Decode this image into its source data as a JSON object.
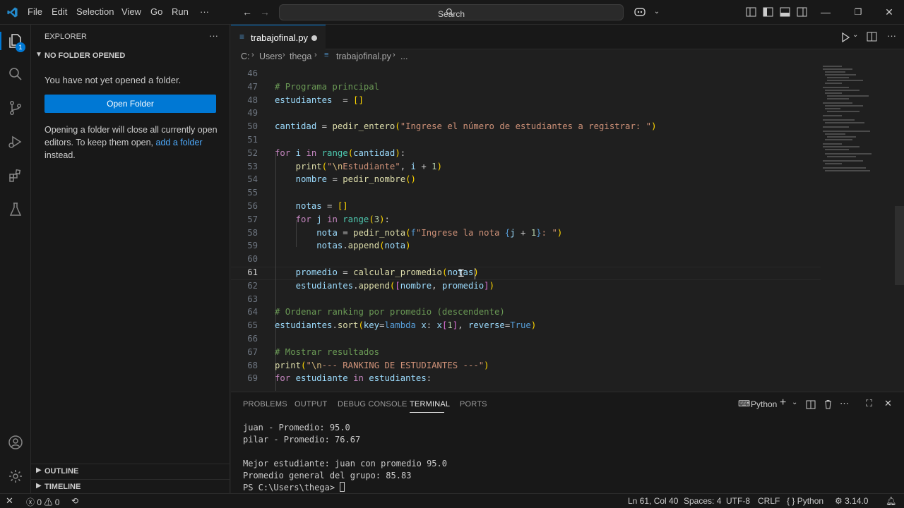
{
  "menu": {
    "file": "File",
    "edit": "Edit",
    "selection": "Selection",
    "view": "View",
    "go": "Go",
    "run": "Run",
    "more": "···"
  },
  "search": {
    "label": "Search"
  },
  "sidebar": {
    "title": "EXPLORER",
    "more": "···",
    "section": "NO FOLDER OPENED",
    "message": "You have not yet opened a folder.",
    "open_folder": "Open Folder",
    "info_1": "Opening a folder will close all currently open",
    "info_2": "editors. To keep them open,",
    "info_link": "add a folder",
    "info_3": "instead.",
    "outline": "OUTLINE",
    "timeline": "TIMELINE"
  },
  "badge": "1",
  "tab": {
    "name": "trabajofinal.py"
  },
  "breadcrumb": {
    "drive": "C:",
    "users": "Users",
    "user": "thega",
    "file": "trabajofinal.py",
    "more": "..."
  },
  "editor": {
    "lines": [
      {
        "n": "46"
      },
      {
        "n": "47",
        "t": [
          [
            "cmt",
            "# Programa principal"
          ]
        ]
      },
      {
        "n": "48",
        "t": [
          [
            "var",
            "estudiantes"
          ],
          [
            "",
            "  = "
          ],
          [
            "br1",
            "[]"
          ]
        ]
      },
      {
        "n": "49"
      },
      {
        "n": "50",
        "t": [
          [
            "var",
            "cantidad"
          ],
          [
            "",
            " = "
          ],
          [
            "fn",
            "pedir_entero"
          ],
          [
            "br1",
            "("
          ],
          [
            "str",
            "\"Ingrese el número de estudiantes a registrar: \""
          ],
          [
            "br1",
            ")"
          ]
        ]
      },
      {
        "n": "51"
      },
      {
        "n": "52",
        "t": [
          [
            "kw",
            "for"
          ],
          [
            "",
            " "
          ],
          [
            "var",
            "i"
          ],
          [
            "",
            " "
          ],
          [
            "kw",
            "in"
          ],
          [
            "",
            " "
          ],
          [
            "cls",
            "range"
          ],
          [
            "br1",
            "("
          ],
          [
            "var",
            "cantidad"
          ],
          [
            "br1",
            ")"
          ],
          [
            "",
            ":"
          ]
        ]
      },
      {
        "n": "53",
        "t": [
          [
            "",
            "    "
          ],
          [
            "fn",
            "print"
          ],
          [
            "br1",
            "("
          ],
          [
            "str",
            "\""
          ],
          [
            "esc",
            "\\n"
          ],
          [
            "str",
            "Estudiante\""
          ],
          [
            "",
            ", "
          ],
          [
            "var",
            "i"
          ],
          [
            "",
            " + "
          ],
          [
            "num",
            "1"
          ],
          [
            "br1",
            ")"
          ]
        ]
      },
      {
        "n": "54",
        "t": [
          [
            "",
            "    "
          ],
          [
            "var",
            "nombre"
          ],
          [
            "",
            " = "
          ],
          [
            "fn",
            "pedir_nombre"
          ],
          [
            "br1",
            "()"
          ]
        ]
      },
      {
        "n": "55"
      },
      {
        "n": "56",
        "t": [
          [
            "",
            "    "
          ],
          [
            "var",
            "notas"
          ],
          [
            "",
            " = "
          ],
          [
            "br1",
            "[]"
          ]
        ]
      },
      {
        "n": "57",
        "t": [
          [
            "",
            "    "
          ],
          [
            "kw",
            "for"
          ],
          [
            "",
            " "
          ],
          [
            "var",
            "j"
          ],
          [
            "",
            " "
          ],
          [
            "kw",
            "in"
          ],
          [
            "",
            " "
          ],
          [
            "cls",
            "range"
          ],
          [
            "br1",
            "("
          ],
          [
            "num",
            "3"
          ],
          [
            "br1",
            ")"
          ],
          [
            "",
            ":"
          ]
        ]
      },
      {
        "n": "58",
        "t": [
          [
            "",
            "        "
          ],
          [
            "var",
            "nota"
          ],
          [
            "",
            " = "
          ],
          [
            "fn",
            "pedir_nota"
          ],
          [
            "br1",
            "("
          ],
          [
            "bl",
            "f"
          ],
          [
            "str",
            "\"Ingrese la nota "
          ],
          [
            "bl",
            "{"
          ],
          [
            "var",
            "j"
          ],
          [
            "",
            " + "
          ],
          [
            "num",
            "1"
          ],
          [
            "bl",
            "}"
          ],
          [
            "str",
            ": \""
          ],
          [
            "br1",
            ")"
          ]
        ]
      },
      {
        "n": "59",
        "t": [
          [
            "",
            "        "
          ],
          [
            "var",
            "notas"
          ],
          [
            "",
            "."
          ],
          [
            "fn",
            "append"
          ],
          [
            "br1",
            "("
          ],
          [
            "var",
            "nota"
          ],
          [
            "br1",
            ")"
          ]
        ]
      },
      {
        "n": "60"
      },
      {
        "n": "61",
        "t": [
          [
            "",
            "    "
          ],
          [
            "var",
            "promedio"
          ],
          [
            "",
            " = "
          ],
          [
            "fn",
            "calcular_promedio"
          ],
          [
            "br1",
            "("
          ],
          [
            "var",
            "notas"
          ],
          [
            "br1",
            ")"
          ]
        ]
      },
      {
        "n": "62",
        "t": [
          [
            "",
            "    "
          ],
          [
            "var",
            "estudiantes"
          ],
          [
            "",
            "."
          ],
          [
            "fn",
            "append"
          ],
          [
            "br1",
            "("
          ],
          [
            "br2",
            "["
          ],
          [
            "var",
            "nombre"
          ],
          [
            "",
            ", "
          ],
          [
            "var",
            "promedio"
          ],
          [
            "br2",
            "]"
          ],
          [
            "br1",
            ")"
          ]
        ]
      },
      {
        "n": "63"
      },
      {
        "n": "64",
        "t": [
          [
            "cmt",
            "# Ordenar ranking por promedio (descendente)"
          ]
        ]
      },
      {
        "n": "65",
        "t": [
          [
            "var",
            "estudiantes"
          ],
          [
            "",
            "."
          ],
          [
            "fn",
            "sort"
          ],
          [
            "br1",
            "("
          ],
          [
            "var",
            "key"
          ],
          [
            "",
            "="
          ],
          [
            "bl",
            "lambda"
          ],
          [
            "",
            " "
          ],
          [
            "var",
            "x"
          ],
          [
            "",
            ": "
          ],
          [
            "var",
            "x"
          ],
          [
            "br2",
            "["
          ],
          [
            "num",
            "1"
          ],
          [
            "br2",
            "]"
          ],
          [
            "",
            ", "
          ],
          [
            "var",
            "reverse"
          ],
          [
            "",
            "="
          ],
          [
            "bl",
            "True"
          ],
          [
            "br1",
            ")"
          ]
        ]
      },
      {
        "n": "66"
      },
      {
        "n": "67",
        "t": [
          [
            "cmt",
            "# Mostrar resultados"
          ]
        ]
      },
      {
        "n": "68",
        "t": [
          [
            "fn",
            "print"
          ],
          [
            "br1",
            "("
          ],
          [
            "str",
            "\""
          ],
          [
            "esc",
            "\\n"
          ],
          [
            "str",
            "--- RANKING DE ESTUDIANTES ---\""
          ],
          [
            "br1",
            ")"
          ]
        ]
      },
      {
        "n": "69",
        "t": [
          [
            "kw",
            "for"
          ],
          [
            "",
            " "
          ],
          [
            "var",
            "estudiante"
          ],
          [
            "",
            " "
          ],
          [
            "kw",
            "in"
          ],
          [
            "",
            " "
          ],
          [
            "var",
            "estudiantes"
          ],
          [
            "",
            ":"
          ]
        ]
      }
    ]
  },
  "panel": {
    "tabs": [
      "PROBLEMS",
      "OUTPUT",
      "DEBUG CONSOLE",
      "TERMINAL",
      "PORTS"
    ],
    "shell": "Python",
    "terminal": [
      "juan - Promedio: 95.0",
      "pilar - Promedio: 76.67",
      "",
      "Mejor estudiante: juan con promedio 95.0",
      "Promedio general del grupo: 85.83",
      "PS C:\\Users\\thega> "
    ]
  },
  "status": {
    "errors": "0",
    "warnings": "0",
    "position": "Ln 61, Col 40",
    "spaces": "Spaces: 4",
    "encoding": "UTF-8",
    "eol": "CRLF",
    "language": "Python",
    "version": "3.14.0"
  },
  "colors": {
    "accent": "#0078d4",
    "background": "#1f1f1f",
    "sidebar": "#181818"
  }
}
